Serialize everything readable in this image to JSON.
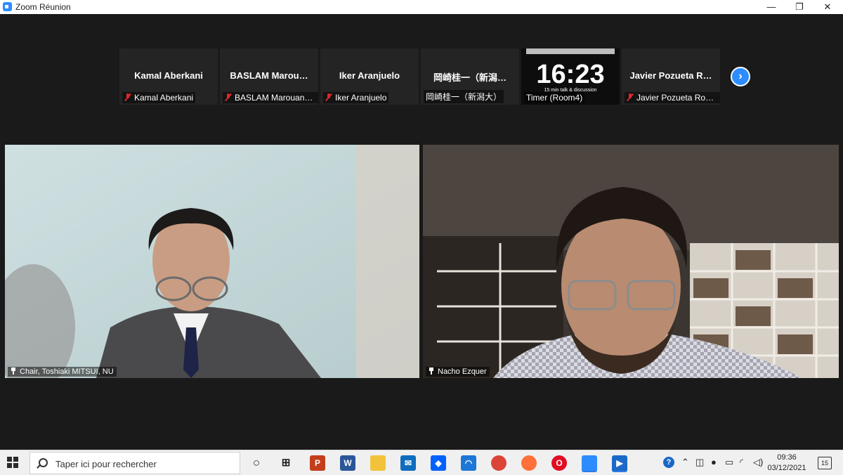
{
  "window": {
    "title": "Zoom Réunion",
    "minimize": "—",
    "restore": "❐",
    "close": "✕"
  },
  "strip": {
    "tiles": [
      {
        "big": "Kamal Aberkani",
        "small": "Kamal Aberkani",
        "muted": true
      },
      {
        "big": "BASLAM  Marou…",
        "small": "BASLAM Marouane, ...",
        "muted": true
      },
      {
        "big": "Iker Aranjuelo",
        "small": "Iker Aranjuelo",
        "muted": true
      },
      {
        "big": "岡崎桂一（新潟…",
        "small": "岡崎桂一（新潟大）",
        "muted": false
      },
      {
        "clock": "16:23",
        "clock_sub": "15 min talk & discussion",
        "small": "Timer (Room4)",
        "muted": false
      },
      {
        "big": "Javier Pozueta R…",
        "small": "Javier Pozueta Romero",
        "muted": true
      }
    ],
    "next_icon": "chevron-right-icon"
  },
  "videos": {
    "left_label": "Chair, Toshiaki MITSUI, NU",
    "right_label": "Nacho Ezquer"
  },
  "taskbar": {
    "search_placeholder": "Taper ici pour rechercher",
    "apps": [
      {
        "name": "powerpoint-icon",
        "glyph": "P",
        "color": "#c43e1c"
      },
      {
        "name": "word-icon",
        "glyph": "W",
        "color": "#2b579a"
      },
      {
        "name": "file-explorer-icon",
        "glyph": "",
        "color": "#f2c23a"
      },
      {
        "name": "mail-icon",
        "glyph": "✉",
        "color": "#0f6cbd"
      },
      {
        "name": "dropbox-icon",
        "glyph": "◆",
        "color": "#0061fe"
      },
      {
        "name": "app-icon",
        "glyph": "◠",
        "color": "#1d77d6"
      },
      {
        "name": "chrome-icon",
        "glyph": "",
        "color": "#db4437"
      },
      {
        "name": "firefox-icon",
        "glyph": "",
        "color": "#ff7139"
      },
      {
        "name": "opera-icon",
        "glyph": "O",
        "color": "#e10c22"
      },
      {
        "name": "zoom-icon",
        "glyph": "",
        "color": "#2d8cff"
      },
      {
        "name": "media-player-icon",
        "glyph": "▶",
        "color": "#1b6ac9"
      }
    ],
    "time": "09:36",
    "date": "03/12/2021",
    "notifications": "15"
  }
}
